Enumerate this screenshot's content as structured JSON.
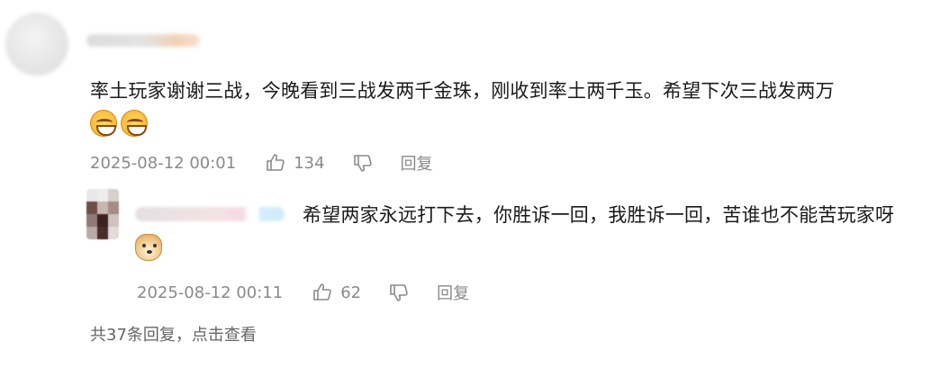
{
  "comment": {
    "text": "率土玩家谢谢三战，今晚看到三战发两千金珠，刚收到率土两千玉。希望下次三战发两万",
    "emojis": [
      "grin-emoji",
      "grin-emoji"
    ],
    "timestamp": "2025-08-12 00:01",
    "like_count": "134",
    "reply_label": "回复"
  },
  "reply": {
    "text": "希望两家永远打下去，你胜诉一回，我胜诉一回，苦谁也不能苦玩家呀",
    "emojis": [
      "doge-emoji"
    ],
    "timestamp": "2025-08-12 00:11",
    "like_count": "62",
    "reply_label": "回复"
  },
  "footer": {
    "view_replies": "共37条回复，点击查看"
  },
  "colors": {
    "text": "#1a1a1a",
    "meta": "#8a8a8a",
    "background": "#ffffff"
  }
}
